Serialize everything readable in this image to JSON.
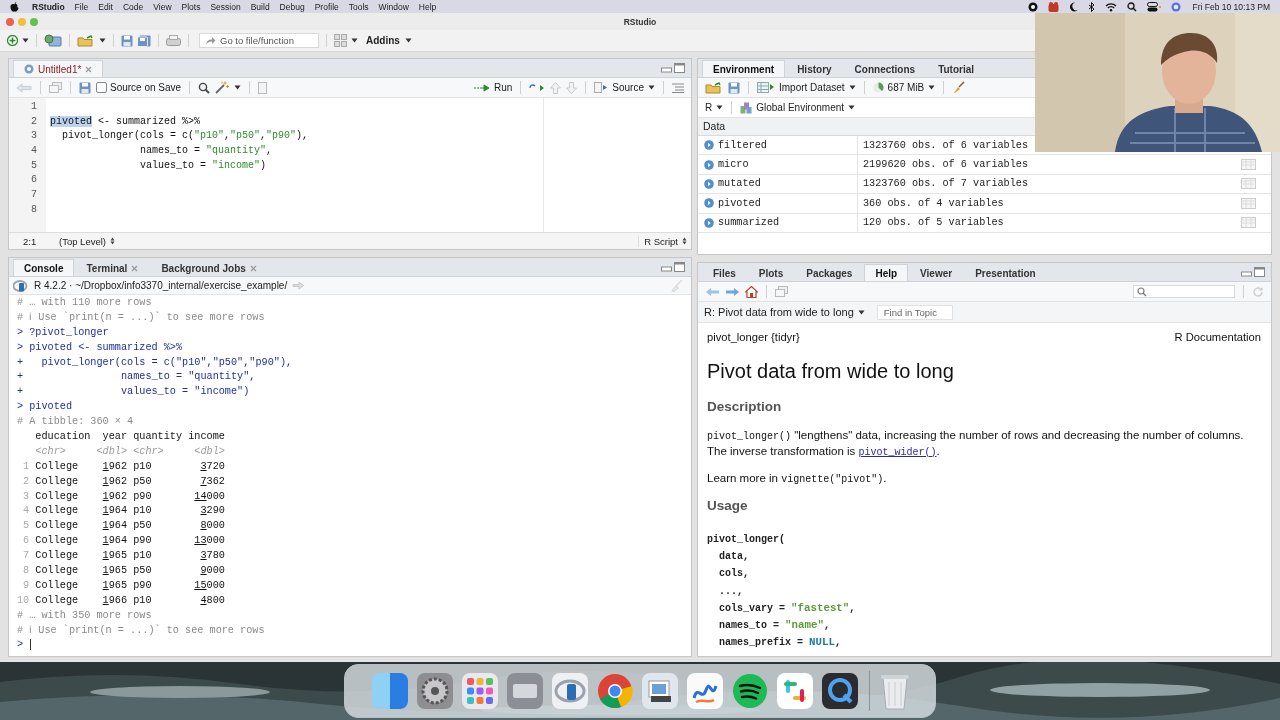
{
  "menu_bar": {
    "app_name": "RStudio",
    "menus": [
      "File",
      "Edit",
      "Code",
      "View",
      "Plots",
      "Session",
      "Build",
      "Debug",
      "Profile",
      "Tools",
      "Window",
      "Help"
    ],
    "clock": "Fri Feb 10  10:13 PM"
  },
  "window": {
    "title": "RStudio"
  },
  "toolbar": {
    "goto_placeholder": "Go to file/function",
    "addins": "Addins"
  },
  "editor": {
    "tabs": [
      {
        "label": "Untitled1*",
        "selected": true
      }
    ],
    "source_on_save": {
      "label": "Source on Save",
      "checked": false
    },
    "run": "Run",
    "source": "Source",
    "lines": [
      {
        "number": "1"
      },
      {
        "number": "2",
        "tokens": [
          {
            "t": "pivoted",
            "kind": "sel"
          },
          {
            "t": " <- summarized %>%",
            "kind": "plain"
          }
        ]
      },
      {
        "number": "3",
        "tokens": [
          {
            "t": "  pivot_longer(cols = c(",
            "kind": "plain"
          },
          {
            "t": "\"p10\"",
            "kind": "string"
          },
          {
            "t": ",",
            "kind": "plain"
          },
          {
            "t": "\"p50\"",
            "kind": "string"
          },
          {
            "t": ",",
            "kind": "plain"
          },
          {
            "t": "\"p90\"",
            "kind": "string"
          },
          {
            "t": "),",
            "kind": "plain"
          }
        ]
      },
      {
        "number": "4",
        "tokens": [
          {
            "t": "               names_to = ",
            "kind": "plain"
          },
          {
            "t": "\"quantity\"",
            "kind": "string"
          },
          {
            "t": ",",
            "kind": "plain"
          }
        ]
      },
      {
        "number": "5",
        "tokens": [
          {
            "t": "               values_to = ",
            "kind": "plain"
          },
          {
            "t": "\"income\"",
            "kind": "string"
          },
          {
            "t": ")",
            "kind": "plain"
          }
        ]
      },
      {
        "number": "6"
      },
      {
        "number": "7"
      },
      {
        "number": "8"
      }
    ],
    "status": {
      "position": "2:1",
      "scope": "(Top Level)",
      "file_type": "R Script"
    }
  },
  "console": {
    "tabs": [
      {
        "label": "Console",
        "selected": true,
        "closable": false
      },
      {
        "label": "Terminal",
        "selected": false,
        "closable": true
      },
      {
        "label": "Background Jobs",
        "selected": false,
        "closable": true
      }
    ],
    "path": "R 4.2.2 · ~/Dropbox/info3370_internal/exercise_example/",
    "lines": [
      {
        "tokens": [
          {
            "t": "# … with 110 more rows",
            "kind": "comment"
          }
        ]
      },
      {
        "tokens": [
          {
            "t": "# ℹ Use `print(n = ...)` to see more rows",
            "kind": "comment"
          }
        ]
      },
      {
        "tokens": [
          {
            "t": "> ",
            "kind": "prompt"
          },
          {
            "t": "?pivot_longer",
            "kind": "input"
          }
        ]
      },
      {
        "tokens": [
          {
            "t": "> ",
            "kind": "prompt"
          },
          {
            "t": "pivoted <- summarized %>%",
            "kind": "input"
          }
        ]
      },
      {
        "tokens": [
          {
            "t": "+ ",
            "kind": "prompt"
          },
          {
            "t": "  pivot_longer(cols = c(\"p10\",\"p50\",\"p90\"),",
            "kind": "input"
          }
        ]
      },
      {
        "tokens": [
          {
            "t": "+ ",
            "kind": "prompt"
          },
          {
            "t": "               names_to = \"quantity\",",
            "kind": "input"
          }
        ]
      },
      {
        "tokens": [
          {
            "t": "+ ",
            "kind": "prompt"
          },
          {
            "t": "               values_to = \"income\")",
            "kind": "input"
          }
        ]
      },
      {
        "tokens": [
          {
            "t": "> ",
            "kind": "prompt"
          },
          {
            "t": "pivoted",
            "kind": "input"
          }
        ]
      },
      {
        "tokens": [
          {
            "t": "# A tibble: 360 × 4",
            "kind": "comment"
          }
        ]
      },
      {
        "tokens": [
          {
            "t": "   education  year quantity income",
            "kind": "plain"
          }
        ]
      },
      {
        "tokens": [
          {
            "t": "   <chr>     <dbl> <chr>     <dbl>",
            "kind": "type"
          }
        ]
      },
      {
        "tokens": [
          {
            "t": " 1",
            "kind": "dim"
          },
          {
            "t": " College    ",
            "kind": "plain"
          },
          {
            "t": "1",
            "kind": "ul"
          },
          {
            "t": "962 p10        ",
            "kind": "plain"
          },
          {
            "t": "3",
            "kind": "ul"
          },
          {
            "t": "720",
            "kind": "plain"
          }
        ]
      },
      {
        "tokens": [
          {
            "t": " 2",
            "kind": "dim"
          },
          {
            "t": " College    ",
            "kind": "plain"
          },
          {
            "t": "1",
            "kind": "ul"
          },
          {
            "t": "962 p50        ",
            "kind": "plain"
          },
          {
            "t": "7",
            "kind": "ul"
          },
          {
            "t": "362",
            "kind": "plain"
          }
        ]
      },
      {
        "tokens": [
          {
            "t": " 3",
            "kind": "dim"
          },
          {
            "t": " College    ",
            "kind": "plain"
          },
          {
            "t": "1",
            "kind": "ul"
          },
          {
            "t": "962 p90       ",
            "kind": "plain"
          },
          {
            "t": "14",
            "kind": "ul"
          },
          {
            "t": "000",
            "kind": "plain"
          }
        ]
      },
      {
        "tokens": [
          {
            "t": " 4",
            "kind": "dim"
          },
          {
            "t": " College    ",
            "kind": "plain"
          },
          {
            "t": "1",
            "kind": "ul"
          },
          {
            "t": "964 p10        ",
            "kind": "plain"
          },
          {
            "t": "3",
            "kind": "ul"
          },
          {
            "t": "290",
            "kind": "plain"
          }
        ]
      },
      {
        "tokens": [
          {
            "t": " 5",
            "kind": "dim"
          },
          {
            "t": " College    ",
            "kind": "plain"
          },
          {
            "t": "1",
            "kind": "ul"
          },
          {
            "t": "964 p50        ",
            "kind": "plain"
          },
          {
            "t": "8",
            "kind": "ul"
          },
          {
            "t": "000",
            "kind": "plain"
          }
        ]
      },
      {
        "tokens": [
          {
            "t": " 6",
            "kind": "dim"
          },
          {
            "t": " College    ",
            "kind": "plain"
          },
          {
            "t": "1",
            "kind": "ul"
          },
          {
            "t": "964 p90       ",
            "kind": "plain"
          },
          {
            "t": "13",
            "kind": "ul"
          },
          {
            "t": "000",
            "kind": "plain"
          }
        ]
      },
      {
        "tokens": [
          {
            "t": " 7",
            "kind": "dim"
          },
          {
            "t": " College    ",
            "kind": "plain"
          },
          {
            "t": "1",
            "kind": "ul"
          },
          {
            "t": "965 p10        ",
            "kind": "plain"
          },
          {
            "t": "3",
            "kind": "ul"
          },
          {
            "t": "780",
            "kind": "plain"
          }
        ]
      },
      {
        "tokens": [
          {
            "t": " 8",
            "kind": "dim"
          },
          {
            "t": " College    ",
            "kind": "plain"
          },
          {
            "t": "1",
            "kind": "ul"
          },
          {
            "t": "965 p50        ",
            "kind": "plain"
          },
          {
            "t": "9",
            "kind": "ul"
          },
          {
            "t": "000",
            "kind": "plain"
          }
        ]
      },
      {
        "tokens": [
          {
            "t": " 9",
            "kind": "dim"
          },
          {
            "t": " College    ",
            "kind": "plain"
          },
          {
            "t": "1",
            "kind": "ul"
          },
          {
            "t": "965 p90       ",
            "kind": "plain"
          },
          {
            "t": "15",
            "kind": "ul"
          },
          {
            "t": "000",
            "kind": "plain"
          }
        ]
      },
      {
        "tokens": [
          {
            "t": "10",
            "kind": "dim"
          },
          {
            "t": " College    ",
            "kind": "plain"
          },
          {
            "t": "1",
            "kind": "ul"
          },
          {
            "t": "966 p10        ",
            "kind": "plain"
          },
          {
            "t": "4",
            "kind": "ul"
          },
          {
            "t": "800",
            "kind": "plain"
          }
        ]
      },
      {
        "tokens": [
          {
            "t": "# … with 350 more rows",
            "kind": "comment"
          }
        ]
      },
      {
        "tokens": [
          {
            "t": "# ℹ Use `print(n = ...)` to see more rows",
            "kind": "comment"
          }
        ]
      },
      {
        "tokens": [
          {
            "t": "> ",
            "kind": "prompt"
          }
        ],
        "cursor": true
      }
    ]
  },
  "environment": {
    "tabs": [
      {
        "label": "Environment",
        "selected": true
      },
      {
        "label": "History",
        "selected": false
      },
      {
        "label": "Connections",
        "selected": false
      },
      {
        "label": "Tutorial",
        "selected": false
      }
    ],
    "import": "Import Dataset",
    "memory": "687 MiB",
    "language": "R",
    "scope": "Global Environment",
    "section": "Data",
    "rows": [
      {
        "name": "filtered",
        "value": "1323760 obs. of 6 variables",
        "view_icon": false
      },
      {
        "name": "micro",
        "value": "2199620 obs. of 6 variables",
        "view_icon": true
      },
      {
        "name": "mutated",
        "value": "1323760 obs. of 7 variables",
        "view_icon": true
      },
      {
        "name": "pivoted",
        "value": "360 obs. of 4 variables",
        "view_icon": true
      },
      {
        "name": "summarized",
        "value": "120 obs. of 5 variables",
        "view_icon": true
      }
    ]
  },
  "help": {
    "tabs": [
      {
        "label": "Files",
        "selected": false
      },
      {
        "label": "Plots",
        "selected": false
      },
      {
        "label": "Packages",
        "selected": false
      },
      {
        "label": "Help",
        "selected": true
      },
      {
        "label": "Viewer",
        "selected": false
      },
      {
        "label": "Presentation",
        "selected": false
      }
    ],
    "topic": "R: Pivot data from wide to long",
    "find_placeholder": "Find in Topic",
    "package": "pivot_longer {tidyr}",
    "doc_label": "R Documentation",
    "title": "Pivot data from wide to long",
    "blocks": [
      {
        "kind": "heading",
        "text": "Description"
      },
      {
        "kind": "paragraph",
        "tokens": [
          {
            "t": "pivot_longer()",
            "kind": "code"
          },
          {
            "t": " \"lengthens\" data, increasing the number of rows and decreasing the number of columns. The inverse transformation is ",
            "kind": "text"
          },
          {
            "t": "pivot_wider()",
            "kind": "link"
          },
          {
            "t": ".",
            "kind": "text"
          }
        ]
      },
      {
        "kind": "paragraph",
        "tokens": [
          {
            "t": "Learn more in ",
            "kind": "text"
          },
          {
            "t": "vignette(\"pivot\")",
            "kind": "code"
          },
          {
            "t": ".",
            "kind": "text"
          }
        ]
      },
      {
        "kind": "heading",
        "text": "Usage"
      },
      {
        "kind": "code",
        "lines": [
          [
            {
              "t": "pivot_longer(",
              "kind": "code"
            }
          ],
          [
            {
              "t": "  data,",
              "kind": "code"
            }
          ],
          [
            {
              "t": "  cols,",
              "kind": "code"
            }
          ],
          [
            {
              "t": "  ...,",
              "kind": "code"
            }
          ],
          [
            {
              "t": "  cols_vary = ",
              "kind": "code"
            },
            {
              "t": "\"fastest\"",
              "kind": "string"
            },
            {
              "t": ",",
              "kind": "code"
            }
          ],
          [
            {
              "t": "  names_to = ",
              "kind": "code"
            },
            {
              "t": "\"name\"",
              "kind": "string"
            },
            {
              "t": ",",
              "kind": "code"
            }
          ],
          [
            {
              "t": "  names_prefix = ",
              "kind": "code"
            },
            {
              "t": "NULL",
              "kind": "null"
            },
            {
              "t": ",",
              "kind": "code"
            }
          ]
        ]
      }
    ]
  }
}
